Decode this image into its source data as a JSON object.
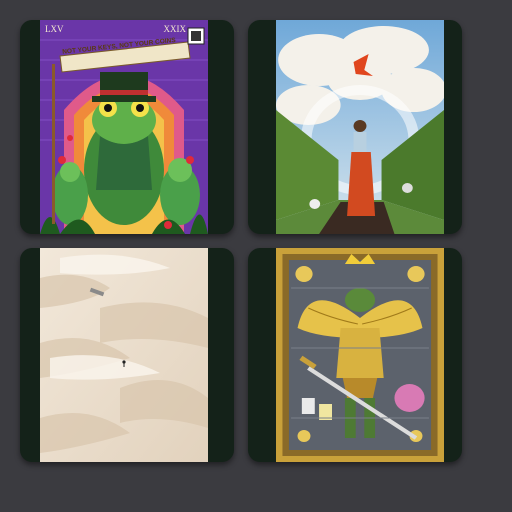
{
  "gallery": {
    "items": [
      {
        "id": "frog-banner",
        "banner_text": "NOT YOUR KEYS, NOT YOUR COINS",
        "corner_left": "LXV",
        "corner_right": "XXIX",
        "colors": {
          "bg": "#7a3fb5",
          "accent": "#e04b8c"
        }
      },
      {
        "id": "hedge-corridor",
        "colors": {
          "sky": "#9cc6e8",
          "hedge": "#4b7a2c"
        }
      },
      {
        "id": "desert-dunes",
        "colors": {
          "sand": "#e9dccb"
        }
      },
      {
        "id": "golden-warrior-card",
        "colors": {
          "frame": "#c9a13a",
          "bg": "#5a5f6a"
        }
      }
    ]
  }
}
